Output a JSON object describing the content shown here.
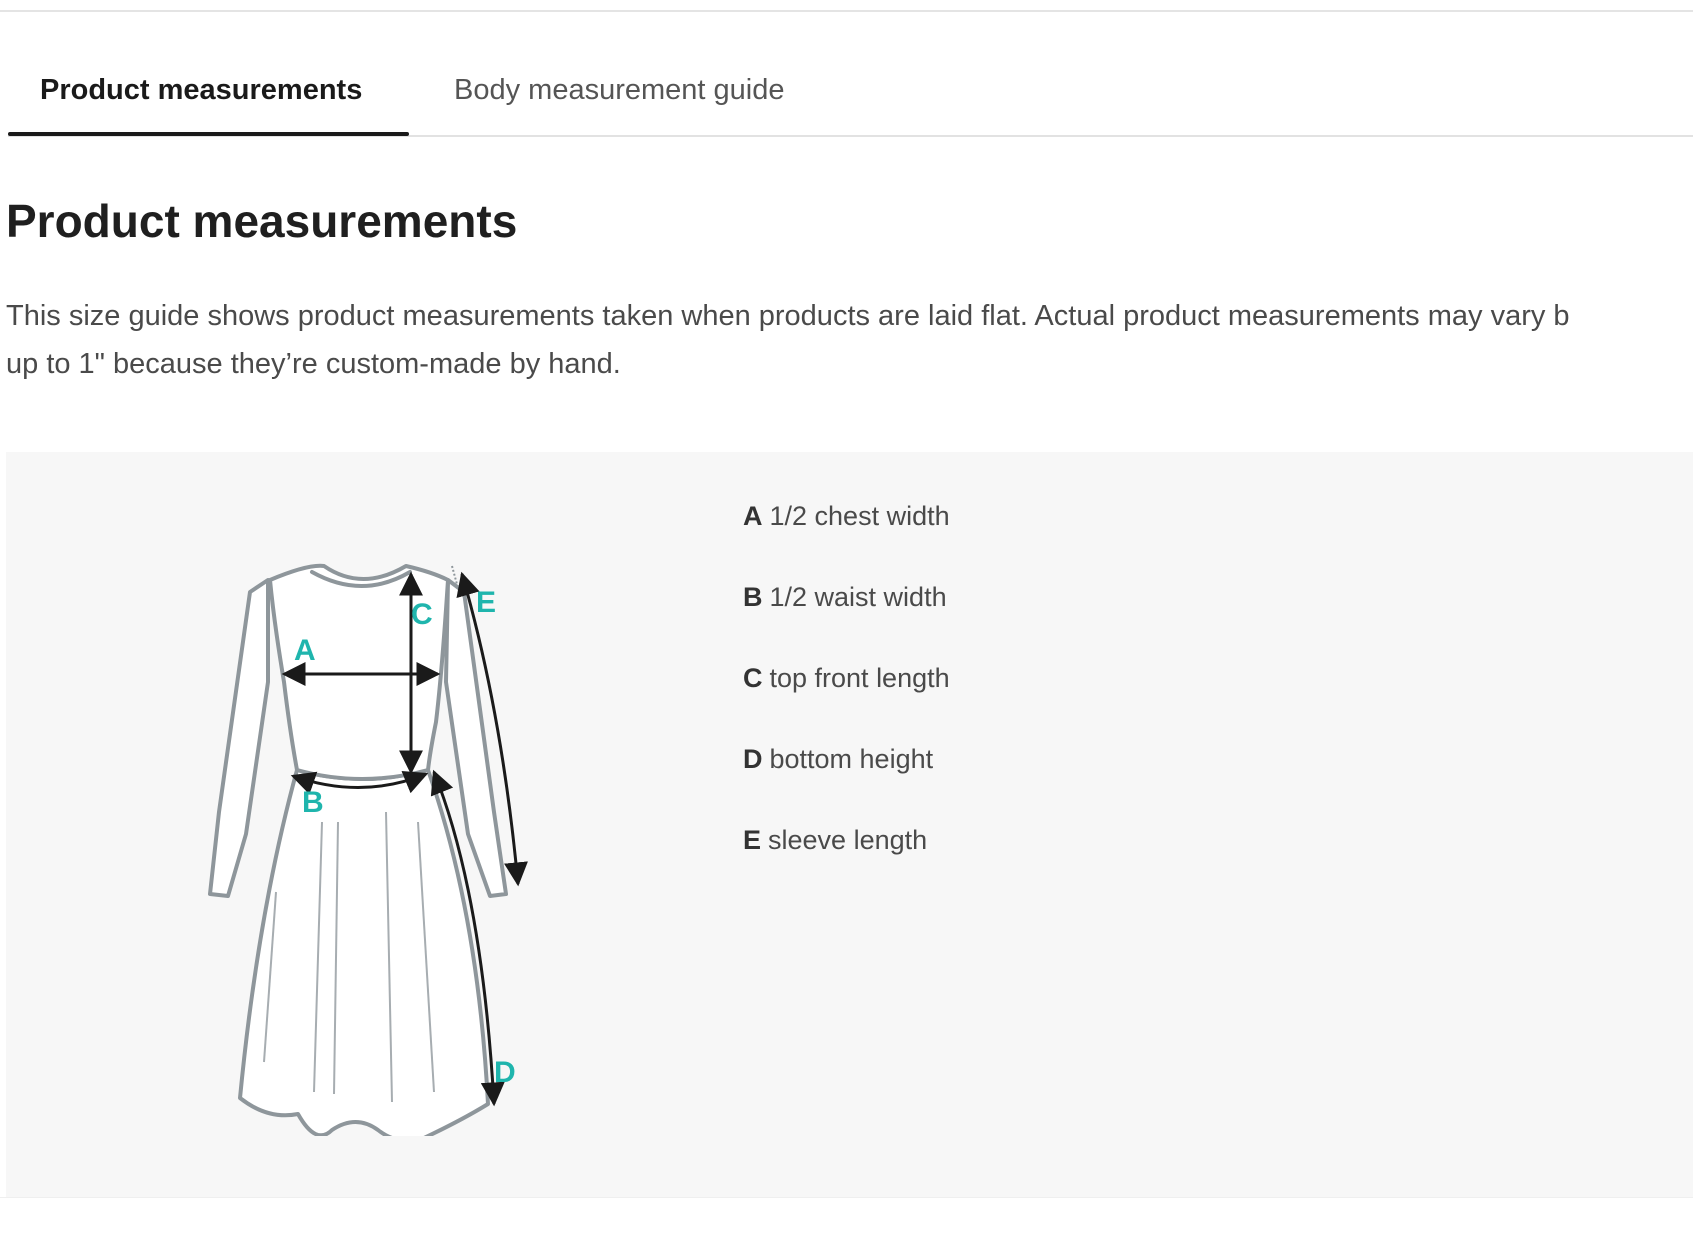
{
  "tabs": [
    {
      "label": "Product measurements",
      "active": true
    },
    {
      "label": "Body measurement guide",
      "active": false
    }
  ],
  "section": {
    "title": "Product measurements",
    "intro_line1": "This size guide shows product measurements taken when products are laid flat. Actual product measurements may vary b",
    "intro_line2": "up to 1\" because they’re custom-made by hand."
  },
  "figure": {
    "icon": "dress-diagram",
    "marker_color": "#1fb5ad",
    "markers": [
      "A",
      "B",
      "C",
      "D",
      "E"
    ]
  },
  "legend": [
    {
      "letter": "A",
      "text": "1/2 chest width"
    },
    {
      "letter": "B",
      "text": "1/2 waist width"
    },
    {
      "letter": "C",
      "text": "top front length"
    },
    {
      "letter": "D",
      "text": "bottom height"
    },
    {
      "letter": "E",
      "text": "sleeve length"
    }
  ]
}
